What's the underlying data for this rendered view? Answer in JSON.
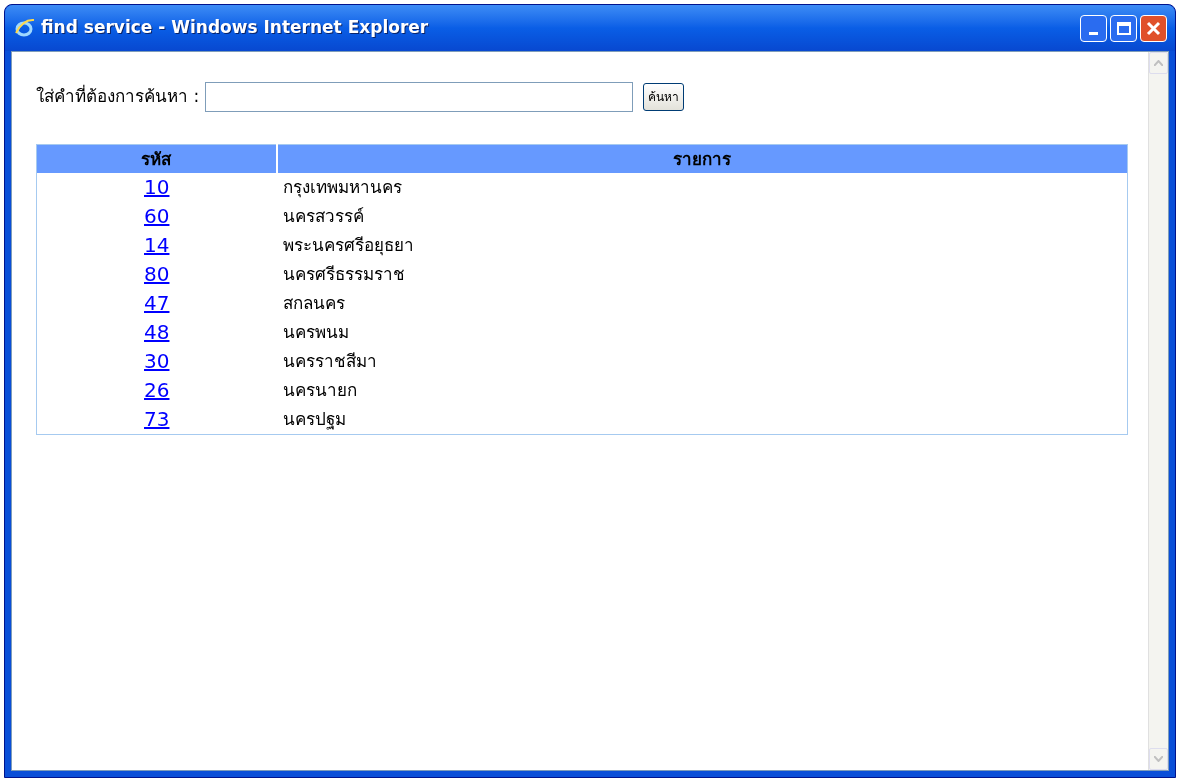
{
  "window": {
    "title": "find service - Windows Internet Explorer"
  },
  "search": {
    "label": "ใส่คำที่ต้องการค้นหา :",
    "button": "ค้นหา"
  },
  "table": {
    "columns": [
      "รหัส",
      "รายการ"
    ],
    "rows": [
      {
        "code": "10",
        "name": "กรุงเทพมหานคร"
      },
      {
        "code": "60",
        "name": "นครสวรรค์"
      },
      {
        "code": "14",
        "name": "พระนครศรีอยุธยา"
      },
      {
        "code": "80",
        "name": "นครศรีธรรมราช"
      },
      {
        "code": "47",
        "name": "สกลนคร"
      },
      {
        "code": "48",
        "name": "นครพนม"
      },
      {
        "code": "30",
        "name": "นครราชสีมา"
      },
      {
        "code": "26",
        "name": "นครนายก"
      },
      {
        "code": "73",
        "name": "นครปฐม"
      }
    ]
  }
}
